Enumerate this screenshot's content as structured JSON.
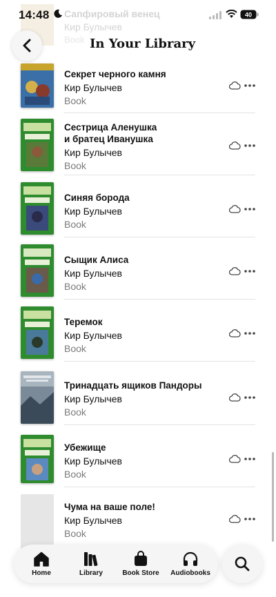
{
  "status_bar": {
    "time": "14:48",
    "battery": "40"
  },
  "header": {
    "title": "In Your Library"
  },
  "ghost_row": {
    "title": "Сапфировый венец",
    "author": "Кир Булычев",
    "kind": "Book"
  },
  "books": [
    {
      "title": "Секрет черного камня",
      "author": "Кир Булычев",
      "kind": "Book"
    },
    {
      "title": "Сестрица Аленушка и братец Иванушка",
      "author": "Кир Булычев",
      "kind": "Book"
    },
    {
      "title": "Синяя борода",
      "author": "Кир Булычев",
      "kind": "Book"
    },
    {
      "title": "Сыщик Алиса",
      "author": "Кир Булычев",
      "kind": "Book"
    },
    {
      "title": "Теремок",
      "author": "Кир Булычев",
      "kind": "Book"
    },
    {
      "title": "Тринадцать ящиков Пандоры",
      "author": "Кир Булычев",
      "kind": "Book"
    },
    {
      "title": "Убежище",
      "author": "Кир Булычев",
      "kind": "Book"
    },
    {
      "title": "Чума на ваше поле!",
      "author": "Кир Булычев",
      "kind": "Book"
    }
  ],
  "tabs": [
    {
      "label": "Home",
      "icon": "home-icon"
    },
    {
      "label": "Library",
      "icon": "library-icon"
    },
    {
      "label": "Book Store",
      "icon": "bag-icon"
    },
    {
      "label": "Audiobooks",
      "icon": "headphones-icon"
    }
  ],
  "colors": {
    "cover_green": "#2e8b2e",
    "cover_gold": "#c8a52a",
    "text_secondary": "#7a7a7a"
  }
}
